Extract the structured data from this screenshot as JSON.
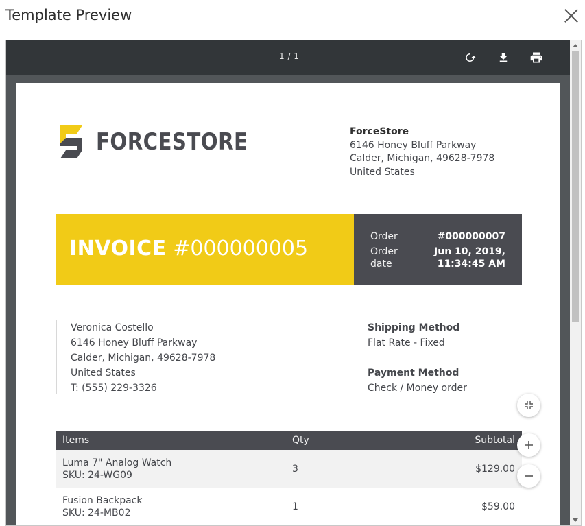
{
  "modal": {
    "title": "Template Preview"
  },
  "viewer": {
    "page_indicator": "1 / 1"
  },
  "store": {
    "logo_text": "FORCESTORE",
    "name": "ForceStore",
    "address_line1": "6146 Honey Bluff Parkway",
    "address_line2": "Calder, Michigan, 49628-7978",
    "country": "United States"
  },
  "invoice": {
    "label": "INVOICE",
    "number": "#000000005",
    "order_label": "Order",
    "order_value": "#000000007",
    "order_date_label_1": "Order",
    "order_date_label_2": "date",
    "order_date_value_1": "Jun 10, 2019,",
    "order_date_value_2": "11:34:45 AM"
  },
  "billing": {
    "name": "Veronica Costello",
    "street": "6146 Honey Bluff Parkway",
    "city": "Calder, Michigan, 49628-7978",
    "country": "United States",
    "phone": "T: (555) 229-3326"
  },
  "shipping": {
    "method_heading": "Shipping Method",
    "method_value": "Flat Rate - Fixed",
    "payment_heading": "Payment Method",
    "payment_value": "Check / Money order"
  },
  "items_table": {
    "headers": {
      "items": "Items",
      "qty": "Qty",
      "subtotal": "Subtotal"
    },
    "rows": [
      {
        "name": "Luma 7\" Analog Watch",
        "sku": "SKU: 24-WG09",
        "qty": "3",
        "subtotal": "$129.00"
      },
      {
        "name": "Fusion Backpack",
        "sku": "SKU: 24-MB02",
        "qty": "1",
        "subtotal": "$59.00"
      }
    ]
  },
  "icons": {
    "rotate": "rotate-icon",
    "download": "download-icon",
    "print": "print-icon",
    "fit": "fit-to-page-icon",
    "zoom_in": "zoom-in-icon",
    "zoom_out": "zoom-out-icon",
    "close": "close-icon"
  },
  "colors": {
    "brand_yellow": "#f1cb17",
    "brand_dark": "#4a4b51",
    "toolbar": "#323639",
    "viewer_bg": "#525659"
  }
}
